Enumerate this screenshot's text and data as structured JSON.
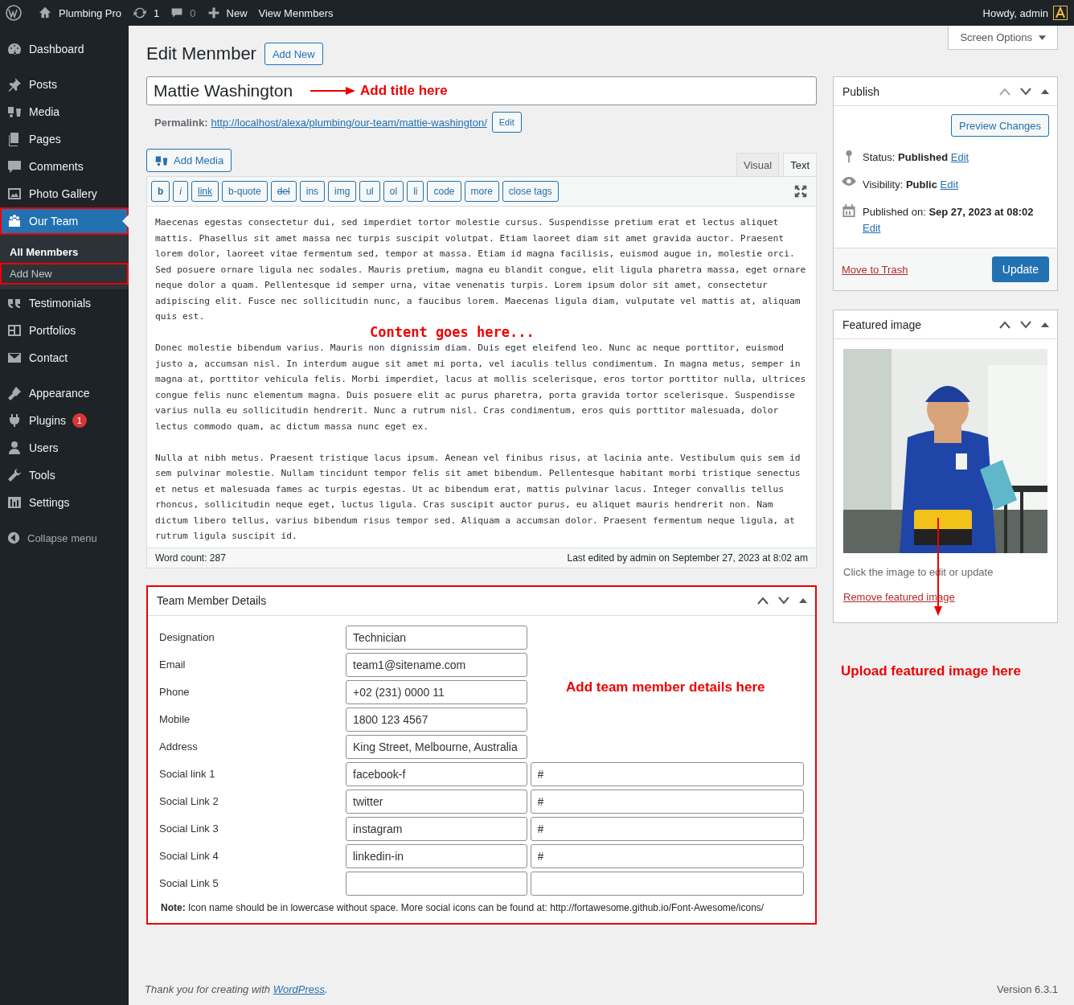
{
  "admin_bar": {
    "site": "Plumbing Pro",
    "updates": "1",
    "comments": "0",
    "new": "New",
    "view": "View Menmbers",
    "greeting": "Howdy, admin"
  },
  "menu_groups": [
    {
      "items": [
        {
          "label": "Dashboard",
          "selected": false,
          "highlighted": false
        }
      ]
    },
    {
      "items": [
        {
          "label": "Posts",
          "selected": false,
          "highlighted": false
        },
        {
          "label": "Media",
          "selected": false,
          "highlighted": false
        },
        {
          "label": "Pages",
          "selected": false,
          "highlighted": false
        },
        {
          "label": "Comments",
          "selected": false,
          "highlighted": false
        },
        {
          "label": "Photo Gallery",
          "selected": false,
          "highlighted": false
        },
        {
          "label": "Our Team",
          "selected": true,
          "highlighted": true,
          "submenu": [
            {
              "label": "All Menmbers",
              "selected": true,
              "highlighted": false
            },
            {
              "label": "Add New",
              "selected": false,
              "highlighted": true
            }
          ]
        },
        {
          "label": "Testimonials",
          "selected": false,
          "highlighted": false
        },
        {
          "label": "Portfolios",
          "selected": false,
          "highlighted": false
        },
        {
          "label": "Contact",
          "selected": false,
          "highlighted": false
        }
      ]
    },
    {
      "items": [
        {
          "label": "Appearance",
          "selected": false,
          "highlighted": false
        },
        {
          "label": "Plugins",
          "selected": false,
          "highlighted": false,
          "badge": "1"
        },
        {
          "label": "Users",
          "selected": false,
          "highlighted": false
        },
        {
          "label": "Tools",
          "selected": false,
          "highlighted": false
        },
        {
          "label": "Settings",
          "selected": false,
          "highlighted": false
        }
      ]
    }
  ],
  "collapse_menu": "Collapse menu",
  "screen_options": "Screen Options",
  "page_title": "Edit Menmber",
  "add_new": "Add New",
  "title_field": {
    "value": "Mattie Washington",
    "annotation": "Add title here"
  },
  "permalink": {
    "label": "Permalink:",
    "url": "http://localhost/alexa/plumbing/our-team/",
    "slug": "mattie-washington",
    "trail": "/",
    "edit": "Edit"
  },
  "add_media": "Add Media",
  "editor_tabs": [
    {
      "label": "Visual",
      "selected": false
    },
    {
      "label": "Text",
      "selected": true
    }
  ],
  "quicktags": [
    {
      "label": "b",
      "kind": "bold"
    },
    {
      "label": "i",
      "kind": "italic"
    },
    {
      "label": "link",
      "kind": "underline"
    },
    {
      "label": "b-quote",
      "kind": "plain"
    },
    {
      "label": "del",
      "kind": "strike"
    },
    {
      "label": "ins",
      "kind": "plain"
    },
    {
      "label": "img",
      "kind": "plain"
    },
    {
      "label": "ul",
      "kind": "plain"
    },
    {
      "label": "ol",
      "kind": "plain"
    },
    {
      "label": "li",
      "kind": "plain"
    },
    {
      "label": "code",
      "kind": "plain"
    },
    {
      "label": "more",
      "kind": "plain"
    },
    {
      "label": "close tags",
      "kind": "plain"
    }
  ],
  "content": [
    {
      "kind": "paragraph",
      "text": "Maecenas egestas consectetur dui, sed imperdiet tortor molestie cursus. Suspendisse pretium erat et lectus aliquet mattis. Phasellus sit amet massa nec turpis suscipit volutpat. Etiam laoreet diam sit amet gravida auctor. Praesent lorem dolor, laoreet vitae fermentum sed, tempor at massa. Etiam id magna facilisis, euismod augue in, molestie orci. Sed posuere ornare ligula nec sodales. Mauris pretium, magna eu blandit congue, elit ligula pharetra massa, eget ornare neque dolor a quam. Pellentesque id semper urna, vitae venenatis turpis. Lorem ipsum dolor sit amet, consectetur adipiscing elit. Fusce nec sollicitudin nunc, a faucibus lorem. Maecenas ligula diam, vulputate vel mattis at, aliquam quis est."
    },
    {
      "kind": "note",
      "text": "Content goes here..."
    },
    {
      "kind": "paragraph",
      "text": "Donec molestie bibendum varius. Mauris non dignissim diam. Duis eget eleifend leo. Nunc ac neque porttitor, euismod justo a, accumsan nisl. In interdum augue sit amet mi porta, vel iaculis tellus condimentum. In magna metus, semper in magna at, porttitor vehicula felis. Morbi imperdiet, lacus at mollis scelerisque, eros tortor porttitor nulla, ultrices congue felis nunc elementum magna. Duis posuere elit ac purus pharetra, porta gravida tortor scelerisque. Suspendisse varius nulla eu sollicitudin hendrerit. Nunc a rutrum nisl. Cras condimentum, eros quis porttitor malesuada, dolor lectus commodo quam, ac dictum massa nunc eget ex."
    },
    {
      "kind": "paragraph",
      "text": "Nulla at nibh metus. Praesent tristique lacus ipsum. Aenean vel finibus risus, at lacinia ante. Vestibulum quis sem id sem pulvinar molestie. Nullam tincidunt tempor felis sit amet bibendum. Pellentesque habitant morbi tristique senectus et netus et malesuada fames ac turpis egestas. Ut ac bibendum erat, mattis pulvinar lacus. Integer convallis tellus rhoncus, sollicitudin neque eget, luctus ligula. Cras suscipit auctor purus, eu aliquet mauris hendrerit non. Nam dictum libero tellus, varius bibendum risus tempor sed. Aliquam a accumsan dolor. Praesent fermentum neque ligula, at rutrum ligula suscipit id."
    }
  ],
  "word_count": "Word count: 287",
  "last_edited": "Last edited by admin on September 27, 2023 at 8:02 am",
  "details": {
    "title": "Team Member Details",
    "annotation": "Add team member details here",
    "rows": [
      {
        "label": "Designation",
        "fields": [
          {
            "kind": "text",
            "value": "Technician"
          }
        ]
      },
      {
        "label": "Email",
        "fields": [
          {
            "kind": "text",
            "value": "team1@sitename.com"
          }
        ]
      },
      {
        "label": "Phone",
        "fields": [
          {
            "kind": "text",
            "value": "+02 (231) 0000 11"
          }
        ]
      },
      {
        "label": "Mobile",
        "fields": [
          {
            "kind": "text",
            "value": "1800 123 4567"
          }
        ]
      },
      {
        "label": "Address",
        "fields": [
          {
            "kind": "text",
            "value": "King Street, Melbourne, Australia"
          }
        ]
      },
      {
        "label": "Social link 1",
        "fields": [
          {
            "kind": "text",
            "value": "facebook-f"
          },
          {
            "kind": "url",
            "value": "#"
          }
        ]
      },
      {
        "label": "Social Link 2",
        "fields": [
          {
            "kind": "text",
            "value": "twitter"
          },
          {
            "kind": "url",
            "value": "#"
          }
        ]
      },
      {
        "label": "Social Link 3",
        "fields": [
          {
            "kind": "text",
            "value": "instagram"
          },
          {
            "kind": "url",
            "value": "#"
          }
        ]
      },
      {
        "label": "Social Link 4",
        "fields": [
          {
            "kind": "text",
            "value": "linkedin-in"
          },
          {
            "kind": "url",
            "value": "#"
          }
        ]
      },
      {
        "label": "Social Link 5",
        "fields": [
          {
            "kind": "text"
          },
          {
            "kind": "url"
          }
        ]
      }
    ],
    "note": "**Note:** Icon name should be in lowercase without space. More social icons can be found at: http://fortawesome.github.io/Font-Awesome/icons/"
  },
  "publish": {
    "title": "Publish",
    "preview": "Preview Changes",
    "meta": [
      {
        "text": "Status: **Published**",
        "edit": "Edit"
      },
      {
        "text": "Visibility: **Public**",
        "edit": "Edit"
      },
      {
        "text": "Published on: **Sep 27, 2023 at 08:02**",
        "edit": "Edit"
      }
    ],
    "trash": "Move to Trash",
    "update": "Update"
  },
  "featured": {
    "title": "Featured image",
    "hint": "Click the image to edit or update",
    "remove": "Remove featured image",
    "annotation": "Upload featured image here"
  },
  "footer": {
    "before": "Thank you for creating with",
    "link": "WordPress",
    "after": ".",
    "version": "Version 6.3.1"
  }
}
